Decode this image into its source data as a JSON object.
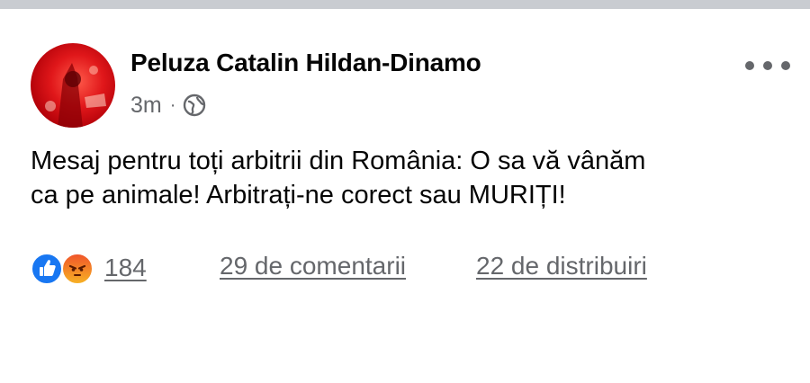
{
  "post": {
    "author": "Peluza Catalin Hildan-Dinamo",
    "timestamp": "3m",
    "separator": "·",
    "privacy_icon": "globe-icon",
    "more_icon": "more-options-icon",
    "text_lines": [
      "Mesaj pentru toți arbitrii din România: O sa vă vânăm",
      "ca pe animale! Arbitrați-ne corect sau MURIȚI!"
    ],
    "reactions": {
      "icons": [
        "like-icon",
        "angry-icon"
      ],
      "count": "184"
    },
    "comments_label": "29 de comentarii",
    "shares_label": "22 de distribuiri"
  },
  "colors": {
    "top_bar": "#c9ccd1",
    "text": "#050505",
    "secondary_text": "#65676b",
    "like_blue": "#1877f2",
    "angry_orange": "#f0552a",
    "avatar_red": "#e0171a"
  }
}
